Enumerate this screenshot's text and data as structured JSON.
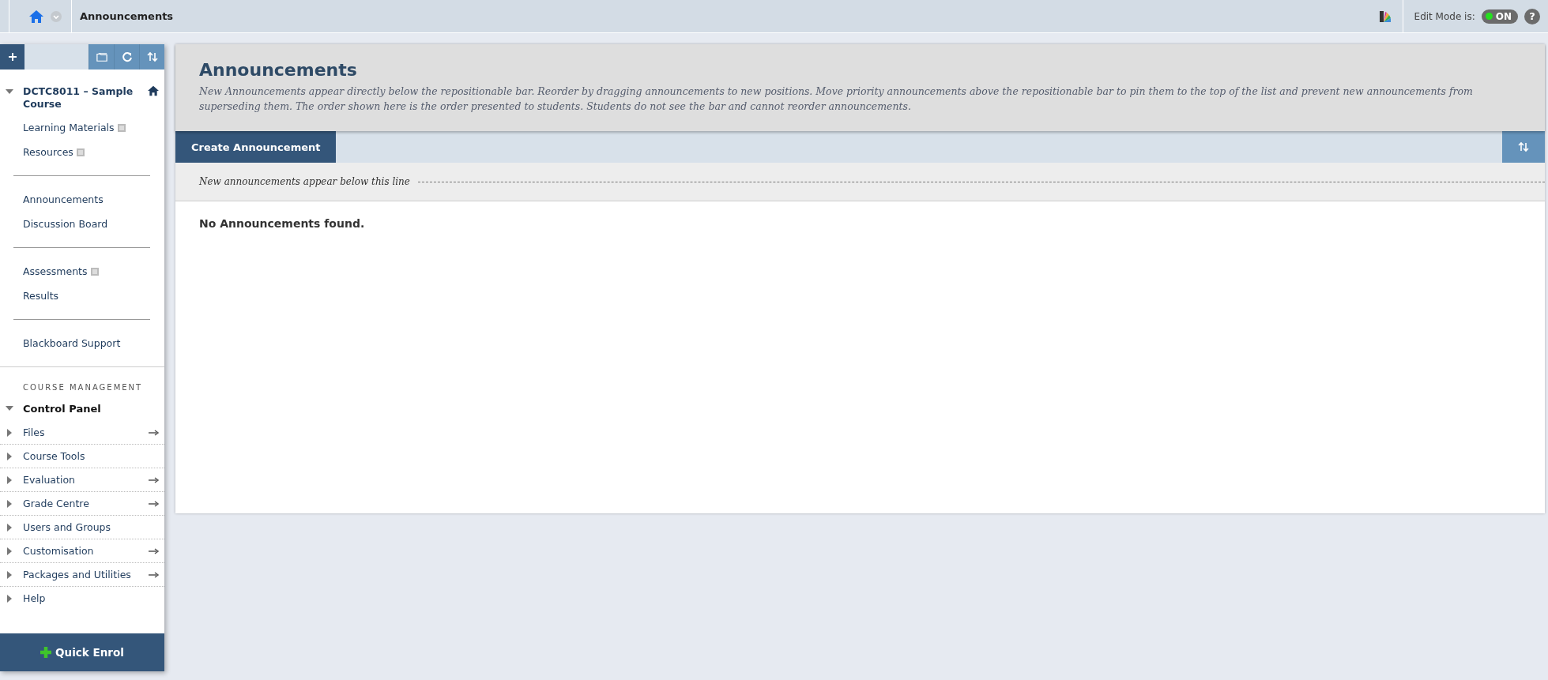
{
  "top_bar": {
    "page_title": "Announcements",
    "edit_mode": {
      "label": "Edit Mode is:",
      "on": true,
      "state_text": "ON"
    },
    "help_text": "?"
  },
  "course_menu": {
    "course_title": "DCTC8011 – Sample Course",
    "expanded": true,
    "groups": [
      {
        "items": [
          {
            "label": "Learning Materials",
            "has_marker": true
          },
          {
            "label": "Resources",
            "has_marker": true
          }
        ]
      },
      {
        "items": [
          {
            "label": "Announcements",
            "has_marker": false
          },
          {
            "label": "Discussion Board",
            "has_marker": false
          }
        ]
      },
      {
        "items": [
          {
            "label": "Assessments",
            "has_marker": true
          },
          {
            "label": "Results",
            "has_marker": false
          }
        ]
      },
      {
        "items": [
          {
            "label": "Blackboard Support",
            "has_marker": false
          }
        ]
      }
    ]
  },
  "course_management": {
    "heading": "COURSE MANAGEMENT",
    "control_panel": {
      "label": "Control Panel",
      "expanded": true
    },
    "items": [
      {
        "label": "Files",
        "arrow": true
      },
      {
        "label": "Course Tools",
        "arrow": false
      },
      {
        "label": "Evaluation",
        "arrow": true
      },
      {
        "label": "Grade Centre",
        "arrow": true
      },
      {
        "label": "Users and Groups",
        "arrow": false
      },
      {
        "label": "Customisation",
        "arrow": true
      },
      {
        "label": "Packages and Utilities",
        "arrow": true
      },
      {
        "label": "Help",
        "arrow": false
      }
    ],
    "quick_enrol": "Quick Enrol"
  },
  "content": {
    "title": "Announcements",
    "description": "New Announcements appear directly below the repositionable bar. Reorder by dragging announcements to new positions. Move priority announcements above the repositionable bar to pin them to the top of the list and prevent new announcements from superseding them. The order shown here is the order presented to students. Students do not see the bar and cannot reorder announcements.",
    "create_button": "Create Announcement",
    "divider_label": "New announcements appear below this line",
    "empty_message": "No Announcements found."
  }
}
